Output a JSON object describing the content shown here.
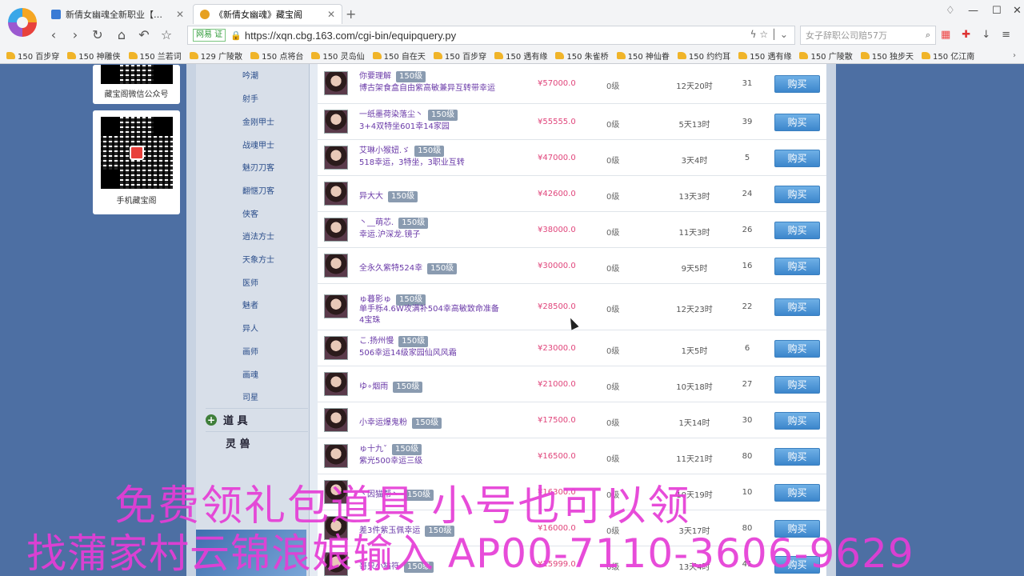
{
  "browser": {
    "tabs": [
      {
        "label": "新倩女幽魂全新职业【吟潮】上",
        "active": false
      },
      {
        "label": "《新倩女幽魂》藏宝阁",
        "active": true
      }
    ],
    "verify_badge": "网易 证",
    "url": "https://xqn.cbg.163.com/cgi-bin/equipquery.py",
    "search_placeholder": "女子辞职公司赔57万",
    "bookmarks": [
      "150 百步穿",
      "150 神雕侠",
      "150 兰若词",
      "129 广陵散",
      "150 点将台",
      "150 灵岛仙",
      "150 自在天",
      "150 百步穿",
      "150 遇有缘",
      "150 朱雀桥",
      "150 神仙眷",
      "150 约约耳",
      "150 遇有缘",
      "150 广陵散",
      "150 独步天",
      "150 亿江南"
    ]
  },
  "qr": {
    "wechat_caption": "藏宝阁微信公众号",
    "mobile_caption": "手机藏宝阁"
  },
  "sidebar": {
    "subitems": [
      "吟潮",
      "射手",
      "金刚甲士",
      "战魂甲士",
      "魅刃刀客",
      "翻惬刀客",
      "侠客",
      "逍法方士",
      "天象方士",
      "医师",
      "魅者",
      "异人",
      "画师",
      "画魂",
      "司星"
    ],
    "categories": [
      "道 具",
      "灵 兽"
    ]
  },
  "listings": [
    {
      "name": "你要理解",
      "level": "150级",
      "desc": "博古架食盒自由紫高敏兼异互转带幸运",
      "price": "¥57000.0",
      "grade": "0级",
      "time": "12天20时",
      "count": "31",
      "buy": "购买"
    },
    {
      "name": "一纸墨荷染落尘丶",
      "level": "150级",
      "desc": "3+4双特坐601幸14家园",
      "price": "¥55555.0",
      "grade": "0级",
      "time": "5天13时",
      "count": "39",
      "buy": "购买"
    },
    {
      "name": "艾琳小猴妞.ゞ",
      "level": "150级",
      "desc": "518幸运，3特坐，3职业互转",
      "price": "¥47000.0",
      "grade": "0级",
      "time": "3天4时",
      "count": "5",
      "buy": "购买"
    },
    {
      "name": "异大大",
      "level": "150级",
      "desc": "",
      "price": "¥42600.0",
      "grade": "0级",
      "time": "13天3时",
      "count": "24",
      "buy": "购买"
    },
    {
      "name": "丶__萌芯.",
      "level": "150级",
      "desc": "幸运.沪深龙.镜子",
      "price": "¥38000.0",
      "grade": "0级",
      "time": "11天3时",
      "count": "26",
      "buy": "购买"
    },
    {
      "name": "全永久紫特524幸",
      "level": "150级",
      "desc": "",
      "price": "¥30000.0",
      "grade": "0级",
      "time": "9天5时",
      "count": "16",
      "buy": "购买"
    },
    {
      "name": "ゅ暮影ゅ",
      "level": "150级",
      "desc": "单手栎4.6W攻满补504幸高敏致命准备4宝珠",
      "price": "¥28500.0",
      "grade": "0级",
      "time": "12天23时",
      "count": "22",
      "buy": "购买"
    },
    {
      "name": "こ.扬州慢",
      "level": "150级",
      "desc": "506幸运14级家园仙风风霜",
      "price": "¥23000.0",
      "grade": "0级",
      "time": "1天5时",
      "count": "6",
      "buy": "购买"
    },
    {
      "name": "ゆ∘烟雨",
      "level": "150级",
      "desc": "",
      "price": "¥21000.0",
      "grade": "0级",
      "time": "10天18时",
      "count": "27",
      "buy": "购买"
    },
    {
      "name": "小幸运爆鬼粉",
      "level": "150级",
      "desc": "",
      "price": "¥17500.0",
      "grade": "0级",
      "time": "1天14时",
      "count": "30",
      "buy": "购买"
    },
    {
      "name": "ゅ十九ˇ",
      "level": "150级",
      "desc": "紫光500幸运三级",
      "price": "¥16500.0",
      "grade": "0级",
      "time": "11天21时",
      "count": "80",
      "buy": "购买"
    },
    {
      "name": "丶因猫帮丶",
      "level": "150级",
      "desc": "",
      "price": "¥16300.0",
      "grade": "0级",
      "time": "10天19时",
      "count": "10",
      "buy": "购买"
    },
    {
      "name": "差3件紫玉佩幸运",
      "level": "150级",
      "desc": "",
      "price": "¥16000.0",
      "grade": "0级",
      "time": "3天17时",
      "count": "80",
      "buy": "购买"
    },
    {
      "name": "哥只小猫符",
      "level": "150级",
      "desc": "",
      "price": "¥15999.0",
      "grade": "0级",
      "time": "13天4时",
      "count": "41",
      "buy": "购买"
    }
  ],
  "overlay": {
    "line1": "免费领礼包道具 小号也可以领",
    "line2": "找蒲家村云锦浪娘输入 AP00-7110-3606-9629"
  }
}
